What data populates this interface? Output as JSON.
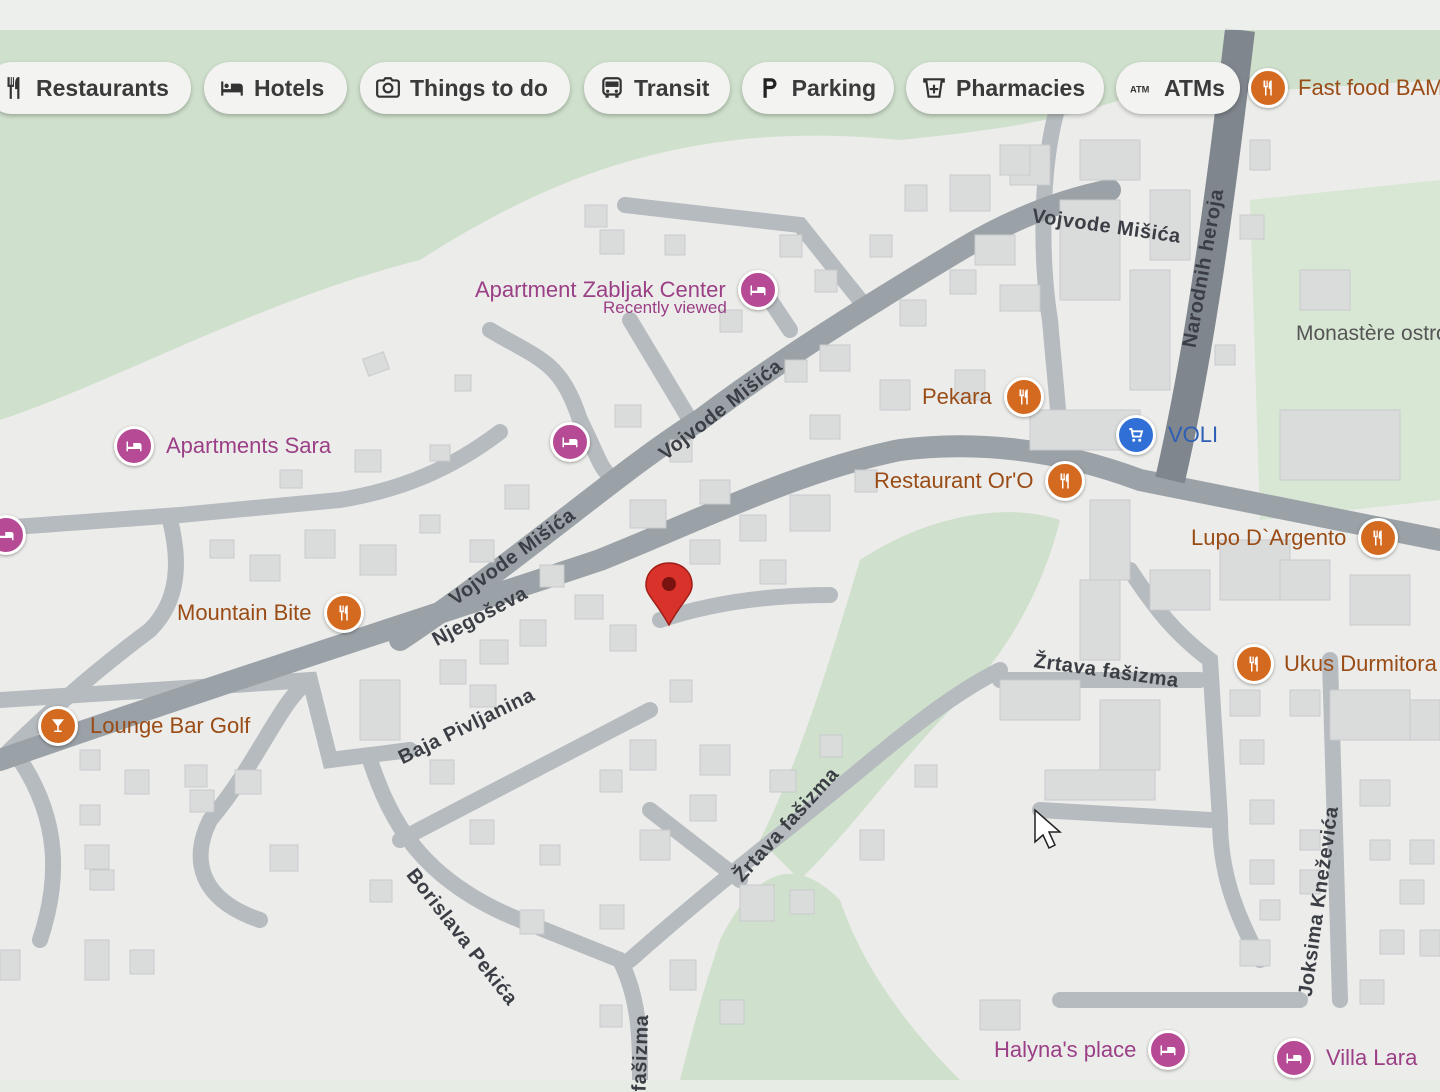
{
  "filter_chips": [
    {
      "label": "Restaurants",
      "icon": "fork-knife-icon"
    },
    {
      "label": "Hotels",
      "icon": "bed-icon"
    },
    {
      "label": "Things to do",
      "icon": "camera-icon"
    },
    {
      "label": "Transit",
      "icon": "bus-icon"
    },
    {
      "label": "Parking",
      "icon": "parking-icon"
    },
    {
      "label": "Pharmacies",
      "icon": "pharmacy-icon"
    },
    {
      "label": "ATMs",
      "icon": "atm-icon"
    }
  ],
  "places": {
    "fast_food": "Fast food BAMI",
    "apartment_center": "Apartment Zabljak Center",
    "apartment_center_note": "Recently viewed",
    "apartments_sara": "Apartments Sara",
    "pekara": "Pekara",
    "voli": "VOLI",
    "restaurant_oro": "Restaurant Or'O",
    "lupo": "Lupo D`Argento",
    "mountain_bite": "Mountain Bite",
    "lounge_bar": "Lounge Bar Golf",
    "ukus": "Ukus Durmitora",
    "halyna": "Halyna's place",
    "villa_lara": "Villa Lara",
    "monastery": "Monastère ostrog"
  },
  "streets": {
    "vojvode_1": "Vojvode Mišića",
    "vojvode_2": "Vojvode Mišića",
    "vojvode_3": "Vojvode Mišića",
    "narodnih": "Narodnih heroja",
    "njegoseva": "Njegoševa",
    "baja": "Baja Pivljanina",
    "zrtava_1": "Žrtava fašizma",
    "zrtava_2": "Žrtava fašizma",
    "zrtava_3": "fašizma",
    "borislava": "Borislava Pekića",
    "joksima": "Joksima Kneževića"
  },
  "colors": {
    "background": "#e7ece4",
    "park": "#cfe3cd",
    "road": "#a7adb3",
    "main_road": "#7f868d",
    "food_pin": "#d36a1f",
    "hotel_pin": "#b64a95",
    "shop_pin": "#2f6fd6",
    "marker": "#d8322b"
  }
}
